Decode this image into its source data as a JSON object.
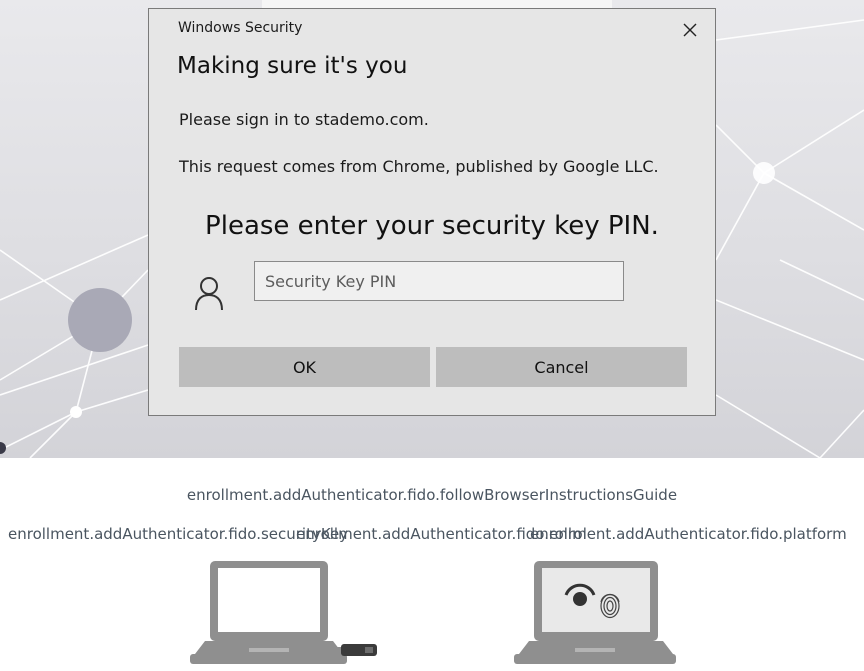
{
  "dialog": {
    "window_title": "Windows Security",
    "heading": "Making sure it's you",
    "line1": "Please sign in to stademo.com.",
    "line2": "This request comes from Chrome, published by Google LLC.",
    "prompt": "Please enter your security key PIN.",
    "pin_placeholder": "Security Key PIN",
    "pin_value": "",
    "ok_label": "OK",
    "cancel_label": "Cancel",
    "icons": {
      "close": "close-icon",
      "user": "user-icon"
    }
  },
  "page": {
    "guide_text": "enrollment.addAuthenticator.fido.followBrowserInstructionsGuide",
    "options": [
      {
        "label": "enrollment.addAuthenticator.fido.securityKey",
        "icon": "laptop-security-key-icon"
      },
      {
        "label": "enrollment.addAuthenticator.fido.enrol",
        "icon": ""
      },
      {
        "label": "enrollment.addAuthenticator.fido.platform",
        "icon": "laptop-biometric-icon"
      }
    ]
  },
  "colors": {
    "dialog_bg": "#e6e6e6",
    "button_bg": "#bdbdbd",
    "label_text": "#4a5560",
    "laptop_gray": "#8f8f8f"
  }
}
